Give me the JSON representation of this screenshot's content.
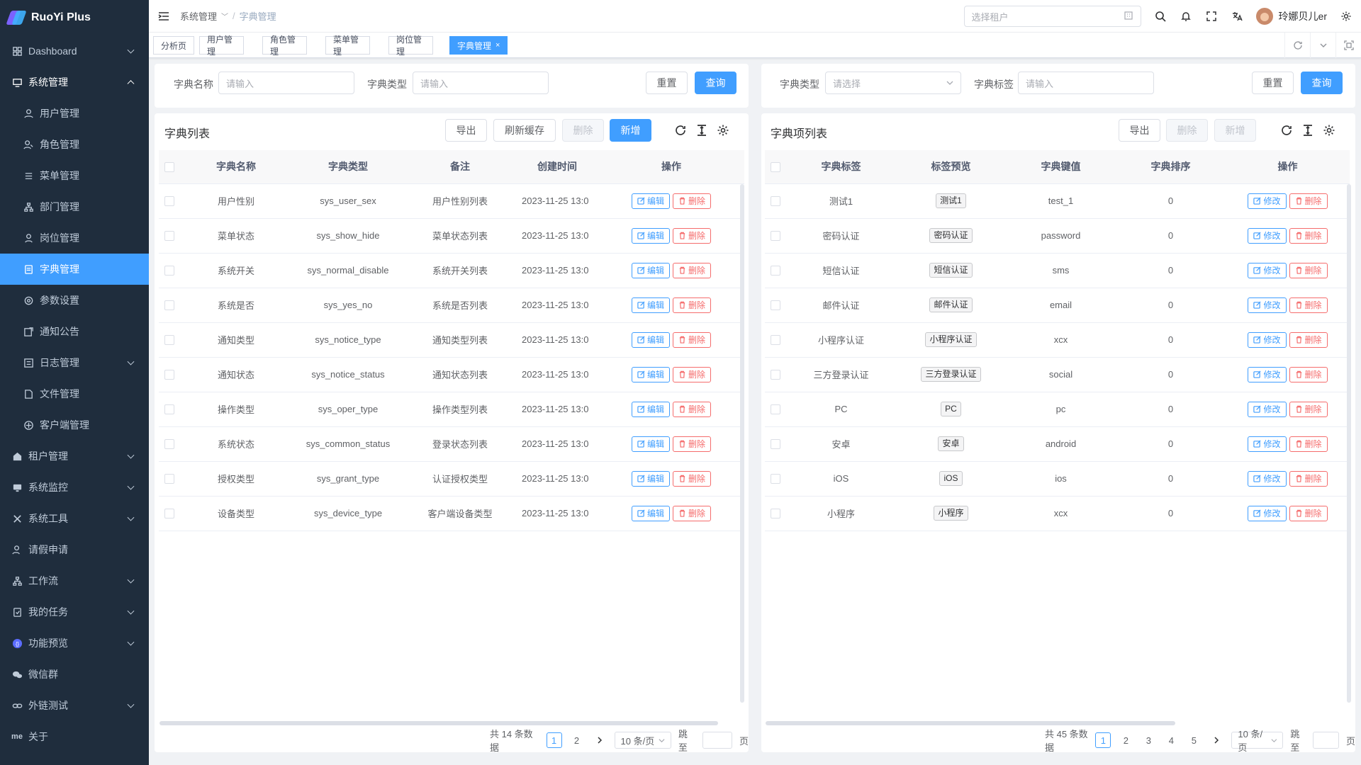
{
  "app": {
    "name": "RuoYi Plus"
  },
  "sidebar": {
    "items": [
      {
        "label": "Dashboard",
        "icon": "dashboard-icon"
      },
      {
        "label": "系统管理",
        "icon": "system-icon"
      },
      {
        "label": "租户管理",
        "icon": "tenant-icon"
      },
      {
        "label": "系统监控",
        "icon": "monitor-icon"
      },
      {
        "label": "系统工具",
        "icon": "tool-icon"
      },
      {
        "label": "请假申请",
        "icon": "leave-icon"
      },
      {
        "label": "工作流",
        "icon": "workflow-icon"
      },
      {
        "label": "我的任务",
        "icon": "task-icon"
      },
      {
        "label": "功能预览",
        "icon": "preview-icon"
      },
      {
        "label": "微信群",
        "icon": "wechat-icon"
      },
      {
        "label": "外链测试",
        "icon": "link-icon"
      },
      {
        "label": "关于",
        "icon": "me-icon",
        "icon_text": "me"
      }
    ],
    "sub": [
      {
        "label": "用户管理"
      },
      {
        "label": "角色管理"
      },
      {
        "label": "菜单管理"
      },
      {
        "label": "部门管理"
      },
      {
        "label": "岗位管理"
      },
      {
        "label": "字典管理"
      },
      {
        "label": "参数设置"
      },
      {
        "label": "通知公告"
      },
      {
        "label": "日志管理"
      },
      {
        "label": "文件管理"
      },
      {
        "label": "客户端管理"
      }
    ]
  },
  "header": {
    "breadcrumb": [
      "系统管理",
      "字典管理"
    ],
    "separator": "/",
    "tenant_placeholder": "选择租户",
    "username": "玲娜贝儿er"
  },
  "tags": [
    {
      "label": "分析页"
    },
    {
      "label": "用户管理"
    },
    {
      "label": "角色管理"
    },
    {
      "label": "菜单管理"
    },
    {
      "label": "岗位管理"
    },
    {
      "label": "字典管理",
      "close": "×"
    }
  ],
  "left": {
    "search": {
      "name_label": "字典名称",
      "name_placeholder": "请输入",
      "type_label": "字典类型",
      "type_placeholder": "请输入",
      "reset": "重置",
      "query": "查询"
    },
    "title": "字典列表",
    "buttons": {
      "export": "导出",
      "refresh": "刷新缓存",
      "delete": "删除",
      "add": "新增"
    },
    "columns": [
      "字典名称",
      "字典类型",
      "备注",
      "创建时间",
      "操作"
    ],
    "rows": [
      {
        "name": "用户性别",
        "type": "sys_user_sex",
        "remark": "用户性别列表",
        "time": "2023-11-25 13:0"
      },
      {
        "name": "菜单状态",
        "type": "sys_show_hide",
        "remark": "菜单状态列表",
        "time": "2023-11-25 13:0"
      },
      {
        "name": "系统开关",
        "type": "sys_normal_disable",
        "remark": "系统开关列表",
        "time": "2023-11-25 13:0"
      },
      {
        "name": "系统是否",
        "type": "sys_yes_no",
        "remark": "系统是否列表",
        "time": "2023-11-25 13:0"
      },
      {
        "name": "通知类型",
        "type": "sys_notice_type",
        "remark": "通知类型列表",
        "time": "2023-11-25 13:0"
      },
      {
        "name": "通知状态",
        "type": "sys_notice_status",
        "remark": "通知状态列表",
        "time": "2023-11-25 13:0"
      },
      {
        "name": "操作类型",
        "type": "sys_oper_type",
        "remark": "操作类型列表",
        "time": "2023-11-25 13:0"
      },
      {
        "name": "系统状态",
        "type": "sys_common_status",
        "remark": "登录状态列表",
        "time": "2023-11-25 13:0"
      },
      {
        "name": "授权类型",
        "type": "sys_grant_type",
        "remark": "认证授权类型",
        "time": "2023-11-25 13:0"
      },
      {
        "name": "设备类型",
        "type": "sys_device_type",
        "remark": "客户端设备类型",
        "time": "2023-11-25 13:0"
      }
    ],
    "row_edit": "编辑",
    "row_delete": "删除",
    "pager": {
      "total": "共 14 条数据",
      "pages": [
        "1",
        "2"
      ],
      "size": "10 条/页",
      "jump": "跳至",
      "page_unit": "页"
    }
  },
  "right": {
    "search": {
      "type_label": "字典类型",
      "type_placeholder": "请选择",
      "label_label": "字典标签",
      "label_placeholder": "请输入",
      "reset": "重置",
      "query": "查询"
    },
    "title": "字典项列表",
    "buttons": {
      "export": "导出",
      "delete": "删除",
      "add": "新增"
    },
    "columns": [
      "字典标签",
      "标签预览",
      "字典键值",
      "字典排序",
      "操作"
    ],
    "rows": [
      {
        "label": "测试1",
        "preview": "测试1",
        "value": "test_1",
        "sort": "0"
      },
      {
        "label": "密码认证",
        "preview": "密码认证",
        "value": "password",
        "sort": "0"
      },
      {
        "label": "短信认证",
        "preview": "短信认证",
        "value": "sms",
        "sort": "0"
      },
      {
        "label": "邮件认证",
        "preview": "邮件认证",
        "value": "email",
        "sort": "0"
      },
      {
        "label": "小程序认证",
        "preview": "小程序认证",
        "value": "xcx",
        "sort": "0"
      },
      {
        "label": "三方登录认证",
        "preview": "三方登录认证",
        "value": "social",
        "sort": "0"
      },
      {
        "label": "PC",
        "preview": "PC",
        "value": "pc",
        "sort": "0"
      },
      {
        "label": "安卓",
        "preview": "安卓",
        "value": "android",
        "sort": "0"
      },
      {
        "label": "iOS",
        "preview": "iOS",
        "value": "ios",
        "sort": "0"
      },
      {
        "label": "小程序",
        "preview": "小程序",
        "value": "xcx",
        "sort": "0"
      }
    ],
    "row_edit": "修改",
    "row_delete": "删除",
    "pager": {
      "total": "共 45 条数据",
      "pages": [
        "1",
        "2",
        "3",
        "4",
        "5"
      ],
      "size": "10 条/页",
      "jump": "跳至",
      "page_unit": "页"
    }
  },
  "colors": {
    "primary": "#409eff",
    "danger": "#f56c6c",
    "sidebar": "#1f2d3d"
  }
}
